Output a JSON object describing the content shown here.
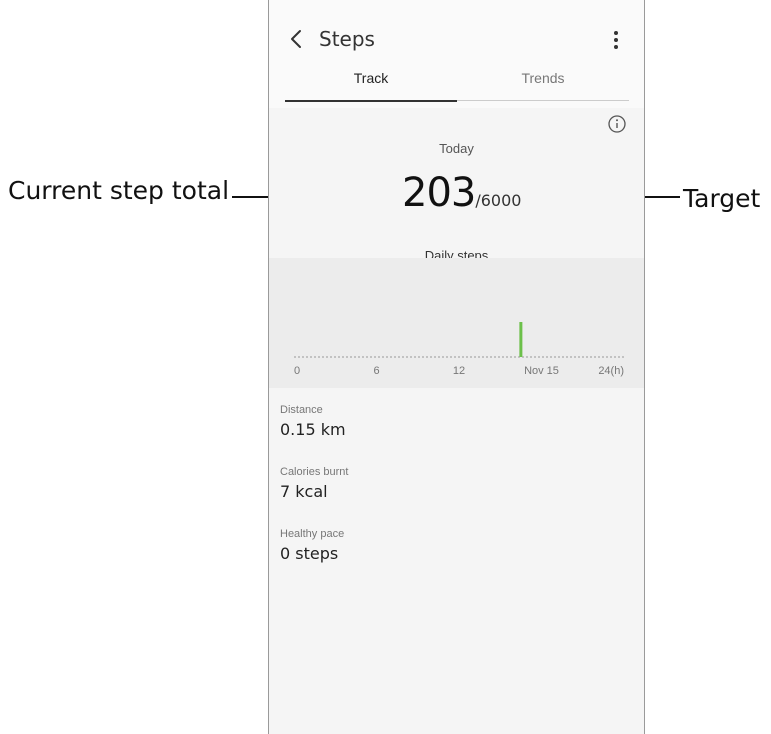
{
  "callouts": {
    "current_step_total": "Current step total",
    "target": "Target"
  },
  "header": {
    "title": "Steps",
    "back_icon": "chevron-left-icon",
    "more_icon": "more-vertical-icon"
  },
  "tabs": [
    {
      "label": "Track",
      "selected": true
    },
    {
      "label": "Trends",
      "selected": false
    }
  ],
  "today": {
    "label": "Today",
    "step_count": "203",
    "step_target": "/6000",
    "caption": "Daily steps"
  },
  "chart_data": {
    "type": "bar",
    "xlabel": "",
    "ylabel": "",
    "x_ticks": [
      "0",
      "6",
      "12",
      "Nov 15",
      "24(h)"
    ],
    "x_range_hours": [
      0,
      24
    ],
    "bars": [
      {
        "hour": 16.5,
        "value": 203
      }
    ],
    "bar_color": "#6cc04a",
    "grid": false
  },
  "stats": [
    {
      "label": "Distance",
      "value": "0.15 km"
    },
    {
      "label": "Calories burnt",
      "value": "7 kcal"
    },
    {
      "label": "Healthy pace",
      "value": "0 steps"
    }
  ],
  "colors": {
    "accent_green": "#6cc04a",
    "chart_bg": "#ececec",
    "screen_bg": "#f5f5f5"
  }
}
